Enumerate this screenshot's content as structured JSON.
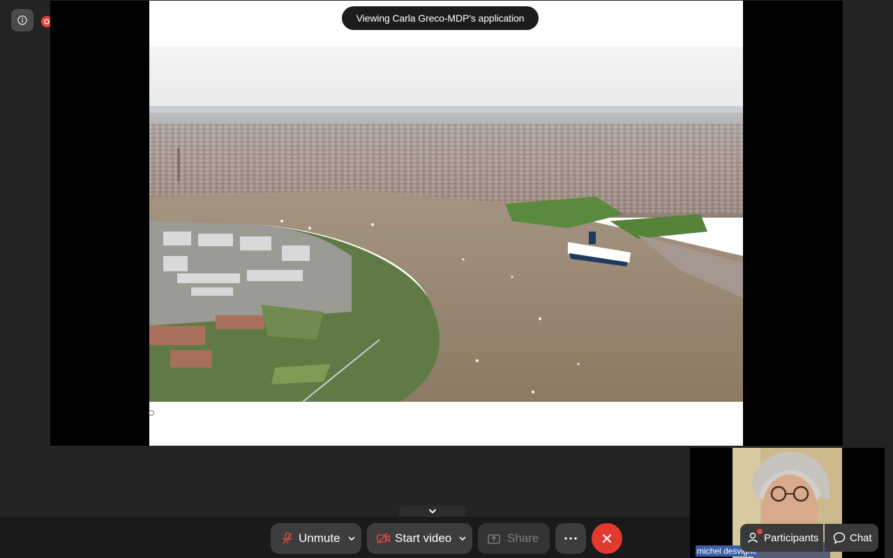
{
  "banner": {
    "viewing_text": "Viewing Carla Greco-MDP's application"
  },
  "indicators": {
    "info_icon": "info-icon",
    "recording_icon": "recording-dot-icon"
  },
  "toolbar": {
    "unmute_label": "Unmute",
    "start_video_label": "Start video",
    "share_label": "Share",
    "more_icon": "ellipsis-icon",
    "end_icon": "close-icon"
  },
  "self_view": {
    "name": "michel desvigne"
  },
  "side_buttons": {
    "participants_label": "Participants",
    "chat_label": "Chat"
  },
  "colors": {
    "end_call": "#e23b2e",
    "recording": "#e8453c",
    "name_highlight": "#3c5fa8"
  }
}
